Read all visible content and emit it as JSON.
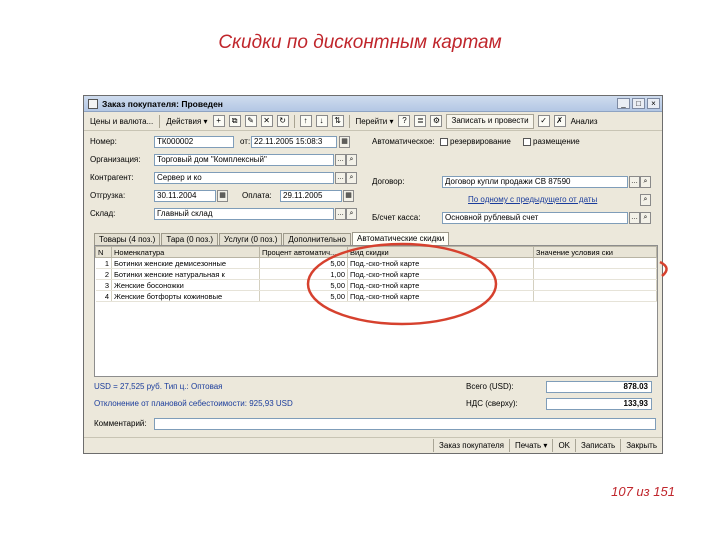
{
  "slide": {
    "title": "Скидки по дисконтным картам",
    "page": "107 из 151"
  },
  "window": {
    "title": "Заказ покупателя: Проведен",
    "controls": [
      "_",
      "□",
      "×"
    ]
  },
  "toolbar": {
    "left_menu": "Цены и валюта...",
    "actions": "Действия ▾",
    "goto": "Перейти ▾",
    "post_button": "Записать и провести",
    "analysis": "Анализ"
  },
  "form": {
    "number_label": "Номер:",
    "number_value": "ТК000002",
    "from_label": "от:",
    "date_value": "22.11.2005 15:08:3",
    "org_label": "Организация:",
    "org_value": "Торговый дом \"Комплексный\"",
    "contractor_label": "Контрагент:",
    "contractor_value": "Сервер и ко",
    "shipment_label": "Отгрузка:",
    "shipment_value": "30.11.2004",
    "payment_label": "Оплата:",
    "payment_value": "29.11.2005",
    "warehouse_label": "Склад:",
    "warehouse_value": "Главный склад",
    "auto_label": "Автоматическое:",
    "reserve_label": "резервирование",
    "placement_label": "размещение",
    "contract_label": "Договор:",
    "contract_value": "Договор купли продажи СВ 87590",
    "link_text": "По одному с предыдущего от даты",
    "bank_label": "Б/счет касса:",
    "bank_value": "Основной рублевый счет"
  },
  "tabs": [
    {
      "label": "Товары (4 поз.)",
      "active": false
    },
    {
      "label": "Тара (0 поз.)",
      "active": false
    },
    {
      "label": "Услуги (0 поз.)",
      "active": false
    },
    {
      "label": "Дополнительно",
      "active": false
    },
    {
      "label": "Автоматические скидки",
      "active": true
    }
  ],
  "table": {
    "headers": [
      "N",
      "Номенклатура",
      "Процент автоматич...",
      "Вид скидки",
      "Значение условия ски"
    ],
    "rows": [
      [
        "1",
        "Ботинки женские демисезонные",
        "5,00",
        "Под.-ско-тной карте",
        ""
      ],
      [
        "2",
        "Ботинки женские натуральная к",
        "1,00",
        "Под.-ско-тной карте",
        ""
      ],
      [
        "3",
        "Женские босоножки",
        "5,00",
        "Под.-ско-тной карте",
        ""
      ],
      [
        "4",
        "Женские ботфорты кожиновые",
        "5,00",
        "Под.-ско-тной карте",
        ""
      ]
    ]
  },
  "totals": {
    "rate_text": "USD = 27,525 руб. Тип ц.: Оптовая",
    "cost_text": "Отклонение от плановой себестоимости: 925,93 USD",
    "comment_label": "Комментарий:",
    "total_label": "Всего (USD):",
    "total_value": "878.03",
    "vat_label": "НДС (сверху):",
    "vat_value": "133,93"
  },
  "bottom": {
    "order": "Заказ покупателя",
    "print": "Печать ▾",
    "ok": "OK",
    "save": "Записать",
    "close": "Закрыть"
  },
  "colors": {
    "title_red": "#c0262c",
    "annotation_red": "#d6412e",
    "window_bg": "#ece8db"
  }
}
